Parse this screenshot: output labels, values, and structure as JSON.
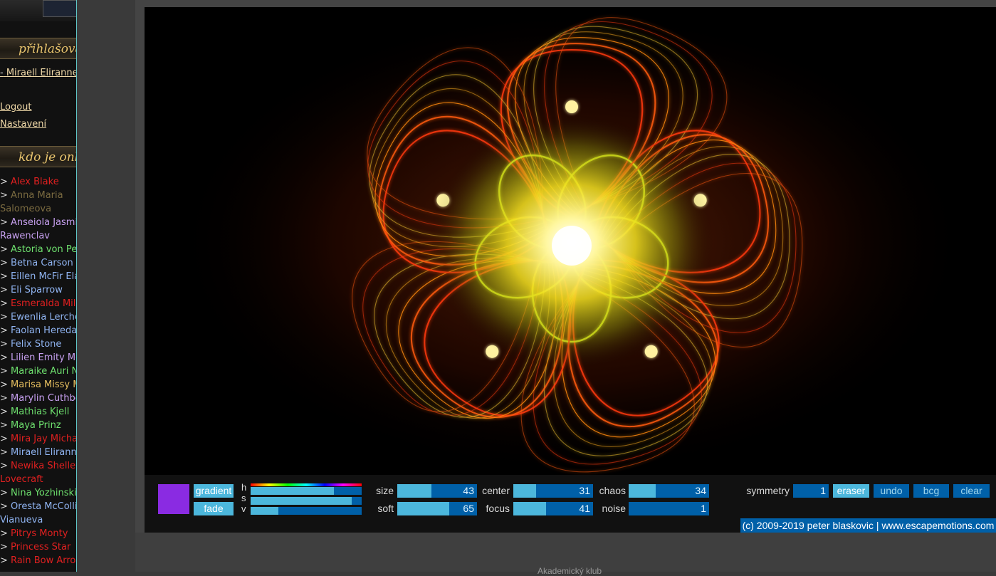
{
  "sidebar": {
    "login_heading": "přihlašova",
    "current_user": "Miraell Eliranne",
    "logout": "Logout",
    "settings": "Nastavení",
    "online_heading": "kdo je onli",
    "users": [
      {
        "name": "Alex Blake",
        "color": "#e02020"
      },
      {
        "name": "Anna Maria",
        "color": "#7a6a40"
      },
      {
        "name": "Salomeova",
        "color": "#7a6a40",
        "wrap": true
      },
      {
        "name": "Anseiola Jasmis",
        "color": "#c7a0f0"
      },
      {
        "name": "Rawenclav",
        "color": "#c7a0f0",
        "wrap": true
      },
      {
        "name": "Astoria von Pens",
        "color": "#6ee06e"
      },
      {
        "name": "Betna Carson",
        "color": "#8fb3f0"
      },
      {
        "name": "Eillen McFir Elat",
        "color": "#8fb3f0"
      },
      {
        "name": "Eli Sparrow",
        "color": "#8fb3f0"
      },
      {
        "name": "Esmeralda Milag",
        "color": "#e02020"
      },
      {
        "name": "Ewenlia Lerche",
        "color": "#8fb3f0"
      },
      {
        "name": "Faolan Heredan",
        "color": "#8fb3f0"
      },
      {
        "name": "Felix Stone",
        "color": "#8fb3f0"
      },
      {
        "name": "Lilien Emity Meis",
        "color": "#c7a0f0"
      },
      {
        "name": "Maraike Auri Nor",
        "color": "#6ee06e"
      },
      {
        "name": "Marisa Missy Mo",
        "color": "#e8c060"
      },
      {
        "name": "Marylin Cuthbert",
        "color": "#c7a0f0"
      },
      {
        "name": "Mathias Kjell",
        "color": "#6ee06e"
      },
      {
        "name": "Maya Prinz",
        "color": "#6ee06e"
      },
      {
        "name": "Mira Jay Michael",
        "color": "#e02020"
      },
      {
        "name": "Miraell Eliranne",
        "color": "#8fb3f0"
      },
      {
        "name": "Newika Shelley",
        "color": "#e02020"
      },
      {
        "name": "Lovecraft",
        "color": "#e02020",
        "wrap": true
      },
      {
        "name": "Nina Yozhinski",
        "color": "#6ee06e"
      },
      {
        "name": "Oresta McCollin",
        "color": "#8fb3f0"
      },
      {
        "name": "Vianueva",
        "color": "#8fb3f0",
        "wrap": true
      },
      {
        "name": "Pitrys Monty",
        "color": "#e02020"
      },
      {
        "name": "Princess Star",
        "color": "#e02020"
      },
      {
        "name": "Rain Bow Arrow",
        "color": "#e02020"
      }
    ]
  },
  "toolbar": {
    "swatch_color": "#8a2be2",
    "gradient_label": "gradient",
    "fade_label": "fade",
    "hsv": {
      "h_label": "h",
      "s_label": "s",
      "v_label": "v",
      "h": 0.75,
      "s": 0.91,
      "v": 0.25
    },
    "sliders": {
      "size": {
        "label": "size",
        "value": "43",
        "fraction": 0.43
      },
      "soft": {
        "label": "soft",
        "value": "65",
        "fraction": 0.65
      },
      "center": {
        "label": "center",
        "value": "31",
        "fraction": 0.29
      },
      "focus": {
        "label": "focus",
        "value": "41",
        "fraction": 0.41
      },
      "chaos": {
        "label": "chaos",
        "value": "34",
        "fraction": 0.34
      },
      "noise": {
        "label": "noise",
        "value": "1",
        "fraction": 0.0
      }
    },
    "symmetry_label": "symmetry",
    "symmetry_value": "1",
    "eraser_label": "eraser",
    "undo_label": "undo",
    "bcg_label": "bcg",
    "clear_label": "clear"
  },
  "copyright": "(c) 2009-2019 peter blaskovic | www.escapemotions.com",
  "bottom_text": "Akademický klub",
  "colors": {
    "button_bg": "#0060a8",
    "button_active": "#4cb7dc"
  }
}
